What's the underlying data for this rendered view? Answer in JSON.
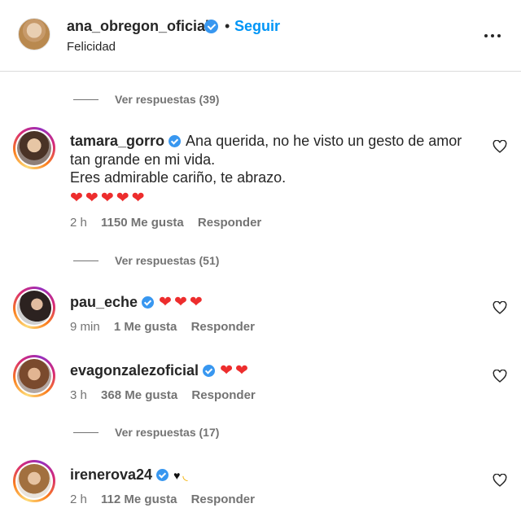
{
  "header": {
    "username": "ana_obregon_oficial",
    "dot": "•",
    "follow_label": "Seguir",
    "subtitle": "Felicidad"
  },
  "view_replies": [
    {
      "label": "Ver respuestas (39)"
    },
    {
      "label": "Ver respuestas (51)"
    },
    {
      "label": "Ver respuestas (17)"
    }
  ],
  "comments": [
    {
      "user": "tamara_gorro",
      "lines": [
        "Ana querida, no he visto un gesto de amor",
        "tan grande en mi vida.",
        "Eres admirable cariño, te abrazo."
      ],
      "emojis": "❤❤❤❤❤",
      "time": "2 h",
      "likes": "1150 Me gusta",
      "reply": "Responder"
    },
    {
      "user": "pau_eche",
      "emojis": "❤❤❤",
      "time": "9 min",
      "likes": "1 Me gusta",
      "reply": "Responder"
    },
    {
      "user": "evagonzalezoficial",
      "emojis": "❤❤",
      "time": "3 h",
      "likes": "368 Me gusta",
      "reply": "Responder"
    },
    {
      "user": "irenerova24",
      "emoji_black_heart": "♥",
      "emoji_wave": "◟",
      "time": "2 h",
      "likes": "112 Me gusta",
      "reply": "Responder"
    }
  ],
  "icons": {
    "verified": "verified-badge-icon",
    "more": "more-options-icon",
    "like": "heart-outline-icon"
  },
  "colors": {
    "follow": "#0095f6",
    "verified": "#3897f0",
    "heart": "#ed2d2d",
    "meta": "#737373"
  }
}
